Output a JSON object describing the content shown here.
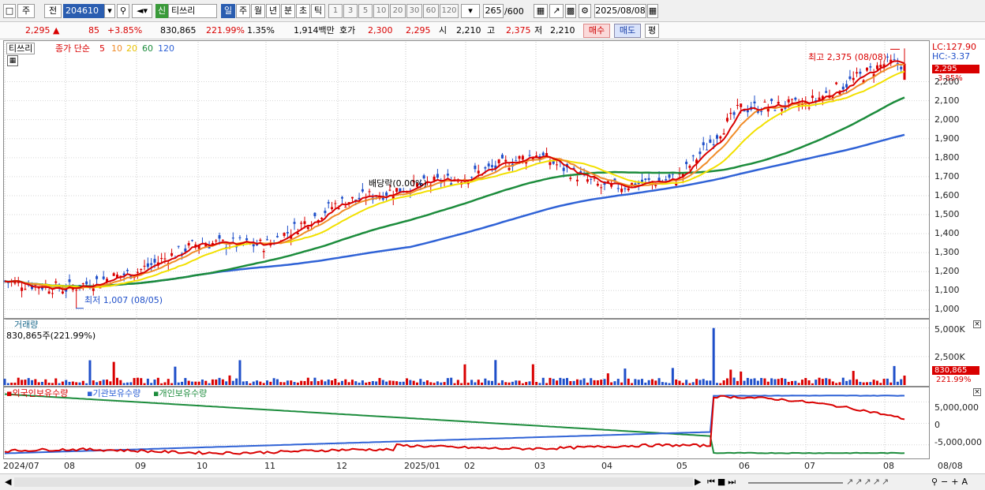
{
  "toolbar": {
    "code": "204610",
    "market_badge": "신",
    "stock_name": "티쓰리",
    "period_buttons": [
      "일",
      "주",
      "월",
      "년",
      "분",
      "초",
      "틱"
    ],
    "interval_buttons": [
      "1",
      "3",
      "5",
      "10",
      "20",
      "30",
      "60",
      "120"
    ],
    "count_current": "265",
    "count_sep": "/600",
    "date": "2025/08/08",
    "left_btn1": "주",
    "left_btn2": "전"
  },
  "quote": {
    "price": "2,295",
    "up_arrow": "▲",
    "change": "85",
    "change_pct": "+3.85%",
    "volume": "830,865",
    "volume_ratio": "221.99%",
    "turnover": "1.35%",
    "amount": "1,914백만",
    "ask_label": "호가",
    "ask1": "2,300",
    "ask2": "2,295",
    "open_label": "시",
    "open": "2,210",
    "high_label": "고",
    "high": "2,375",
    "low_label": "저",
    "low": "2,210",
    "buy": "매수",
    "sell": "매도",
    "eval": "평"
  },
  "price_panel": {
    "stock_tag": "티쓰리",
    "ma_title": "종가 단순",
    "ma_periods": [
      "5",
      "10",
      "20",
      "60",
      "120"
    ],
    "lc": "LC:127.90",
    "hc": "HC:-3.37",
    "price_tag": "2,295",
    "pct_tag": "3.85%",
    "high_note": "최고 2,375 (08/08)",
    "low_note": "최저 1,007 (08/05)",
    "div_note": "배당락(0.00%)"
  },
  "volume_panel": {
    "title": "거래량",
    "sub": "830,865주(221.99%)",
    "ticks": [
      "5,000K",
      "2,500K"
    ],
    "tag": "830,865",
    "tag_pct": "221.99%"
  },
  "holdings_panel": {
    "series": [
      "외국인보유수량",
      "기관보유수량",
      "개인보유수량"
    ],
    "ticks": [
      "5,000,000",
      "0",
      "-5,000,000"
    ]
  },
  "x_labels": [
    "2024/07",
    "08",
    "09",
    "10",
    "11",
    "12",
    "2025/01",
    "02",
    "03",
    "04",
    "05",
    "06",
    "07",
    "08"
  ],
  "x_right": "08/08",
  "colors": {
    "up": "#d90000",
    "down": "#1f4fc9",
    "ma5": "#d90000",
    "ma10": "#f08c28",
    "ma20": "#f2e000",
    "ma60": "#1c8c3c",
    "ma120": "#2f62d6"
  },
  "chart_data": [
    {
      "type": "candlestick",
      "title": "티쓰리",
      "y_ticks": [
        1000,
        1100,
        1200,
        1300,
        1400,
        1500,
        1600,
        1700,
        1800,
        1900,
        2000,
        2100,
        2200
      ],
      "ylim": [
        960,
        2410
      ],
      "x_range": [
        "2024/07",
        "2025/08/08"
      ],
      "approx_close_by_month": [
        {
          "x": "2024/07",
          "close": 1150
        },
        {
          "x": "2024/08",
          "close": 1110
        },
        {
          "x": "2024/09",
          "close": 1200
        },
        {
          "x": "2024/10",
          "close": 1350
        },
        {
          "x": "2024/11",
          "close": 1340
        },
        {
          "x": "2024/12",
          "close": 1560
        },
        {
          "x": "2025/01",
          "close": 1640
        },
        {
          "x": "2025/02",
          "close": 1700
        },
        {
          "x": "2025/03",
          "close": 1820
        },
        {
          "x": "2025/04",
          "close": 1640
        },
        {
          "x": "2025/05",
          "close": 1690
        },
        {
          "x": "2025/06",
          "close": 2060
        },
        {
          "x": "2025/07",
          "close": 2080
        },
        {
          "x": "2025/08/08",
          "close": 2295
        }
      ],
      "high": {
        "value": 2375,
        "date": "08/08"
      },
      "low": {
        "value": 1007,
        "date": "08/05"
      },
      "ma_series": [
        "5",
        "10",
        "20",
        "60",
        "120"
      ]
    },
    {
      "type": "bar",
      "title": "거래량",
      "y_ticks": [
        "2,500K",
        "5,000K"
      ],
      "last_value": 830865,
      "peak_value": 5000000,
      "peak_x": "2025/05"
    },
    {
      "type": "line",
      "series": [
        {
          "name": "외국인보유수량",
          "color": "#d90000",
          "start": -6500000,
          "end": 1500000,
          "approx_peak": 6200000,
          "peak_x": "2025/06"
        },
        {
          "name": "기관보유수량",
          "color": "#2f62d6",
          "start": -7000000,
          "end": 6400000
        },
        {
          "name": "개인보유수량",
          "color": "#1c8c3c",
          "start": 6800000,
          "end": -7000000
        }
      ],
      "y_ticks": [
        5000000,
        0,
        -5000000
      ]
    }
  ]
}
